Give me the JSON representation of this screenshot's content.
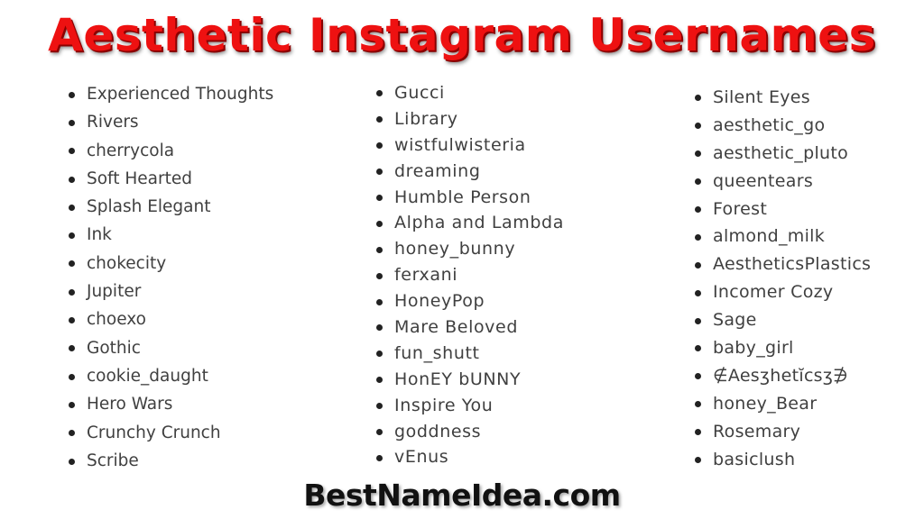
{
  "title": "Aesthetic Instagram Usernames",
  "colors": {
    "title": "#ee1111",
    "text": "#404040",
    "bullet": "#222222",
    "footer": "#111111",
    "background": "#ffffff"
  },
  "columns": [
    {
      "items": [
        "Experienced Thoughts",
        "Rivers",
        "cherrycola",
        "Soft Hearted",
        "Splash Elegant",
        "Ink",
        "chokecity",
        "Jupiter",
        "choexo",
        "Gothic",
        "cookie_daught",
        "Hero Wars",
        "Crunchy Crunch",
        "Scribe"
      ]
    },
    {
      "items": [
        "Gucci",
        "Library",
        "wistfulwisteria",
        "dreaming",
        "Humble Person",
        "Alpha and Lambda",
        "honey_bunny",
        "ferxani",
        "HoneyPop",
        "Mare Beloved",
        "fun_shutt",
        "HonEY bUNNY",
        "Inspire You",
        "goddness",
        "vEnus"
      ]
    },
    {
      "items": [
        "Silent Eyes",
        "aesthetic_go",
        "aesthetic_pluto",
        "queentears",
        "Forest",
        "almond_milk",
        "AestheticsPlastics",
        "Incomer Cozy",
        "Sage",
        "baby_girl",
        "∉Aesʒhetĭcsʒ∌",
        "honey_Bear",
        "Rosemary",
        "basiclush"
      ]
    }
  ],
  "footer": "BestNameIdea.com"
}
